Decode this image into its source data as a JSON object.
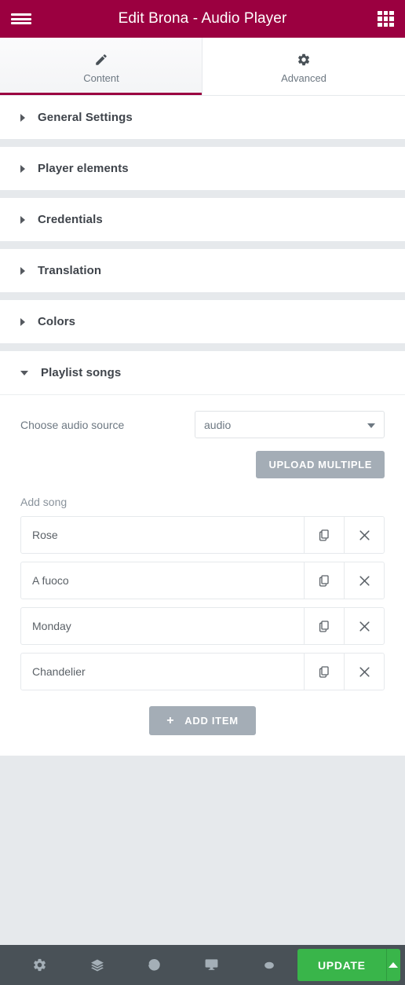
{
  "header": {
    "title": "Edit Brona - Audio Player",
    "menu_icon": "hamburger-menu-icon",
    "widgets_icon": "widgets-grid-icon",
    "bg_color": "#9b0040"
  },
  "tabs": [
    {
      "label": "Content",
      "icon": "pencil-icon",
      "active": true
    },
    {
      "label": "Advanced",
      "icon": "gear-icon",
      "active": false
    }
  ],
  "sections": [
    {
      "title": "General Settings",
      "expanded": false
    },
    {
      "title": "Player elements",
      "expanded": false
    },
    {
      "title": "Credentials",
      "expanded": false
    },
    {
      "title": "Translation",
      "expanded": false
    },
    {
      "title": "Colors",
      "expanded": false
    },
    {
      "title": "Playlist songs",
      "expanded": true
    }
  ],
  "playlist": {
    "audio_source_label": "Choose audio source",
    "audio_source_value": "audio",
    "audio_source_options": [
      "audio"
    ],
    "upload_multiple_label": "UPLOAD MULTIPLE",
    "add_song_label": "Add song",
    "songs": [
      {
        "title": "Rose"
      },
      {
        "title": "A fuoco"
      },
      {
        "title": "Monday"
      },
      {
        "title": "Chandelier"
      }
    ],
    "duplicate_icon": "duplicate-icon",
    "remove_icon": "close-icon",
    "add_item_label": "ADD ITEM",
    "add_item_plus": "+"
  },
  "footer": {
    "tools": [
      {
        "name": "settings-gear-icon",
        "label": "Settings"
      },
      {
        "name": "navigator-layers-icon",
        "label": "Navigator"
      },
      {
        "name": "history-icon",
        "label": "History"
      },
      {
        "name": "responsive-mode-icon",
        "label": "Responsive Mode"
      },
      {
        "name": "preview-eye-icon",
        "label": "Preview Changes"
      }
    ],
    "update_label": "UPDATE",
    "update_color": "#39b54a"
  }
}
